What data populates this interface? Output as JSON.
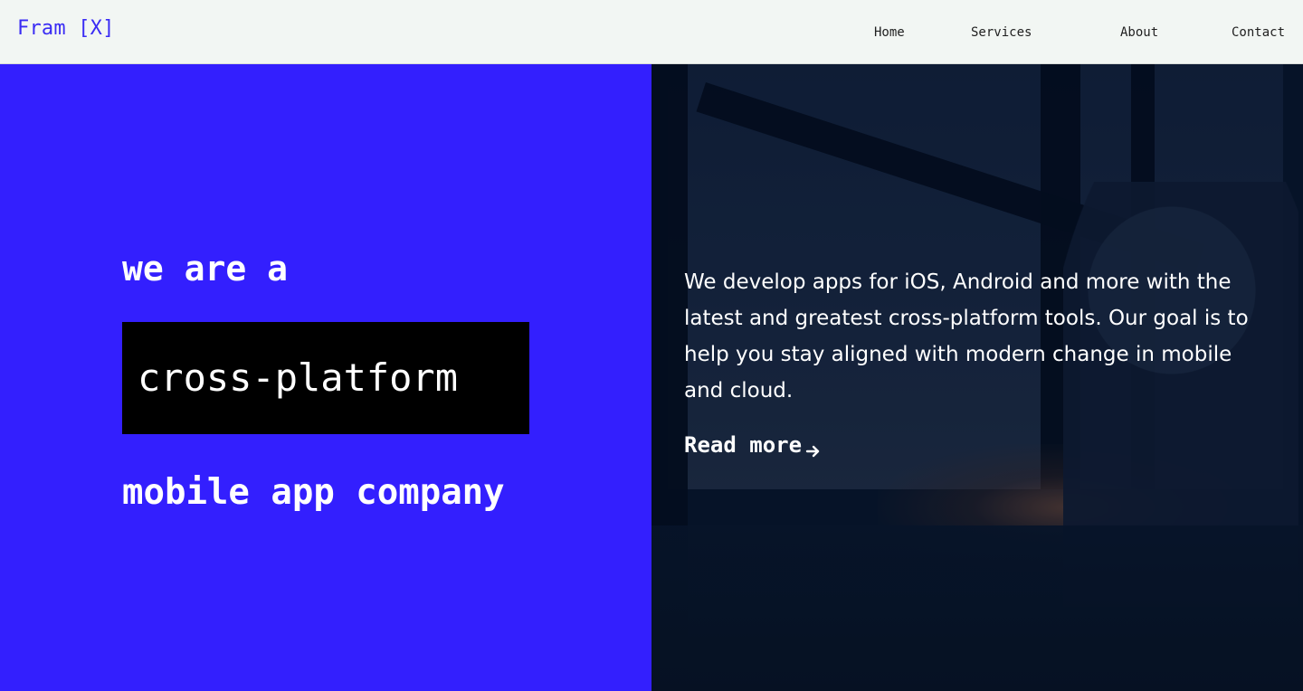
{
  "header": {
    "logo_text": "Fram [X]",
    "nav": {
      "home": "Home",
      "services": "Services",
      "about": "About",
      "contact": "Contact"
    }
  },
  "hero": {
    "left": {
      "line_1": "we are a",
      "highlight": "cross-platform",
      "line_3": "mobile app company"
    },
    "right": {
      "description": "We develop apps for iOS, Android and more with the latest and greatest cross-platform tools. Our goal is to help you stay aligned with modern change in mobile and cloud.",
      "read_more": "Read more",
      "arrow_icon": "arrow-right-icon"
    }
  },
  "colors": {
    "brand": "#331ffe",
    "header_bg": "#f2f6f3",
    "text_dark": "#1f1f1f",
    "text_light": "#ffffff",
    "highlight_bg": "#000000",
    "image_overlay": "#061326"
  }
}
